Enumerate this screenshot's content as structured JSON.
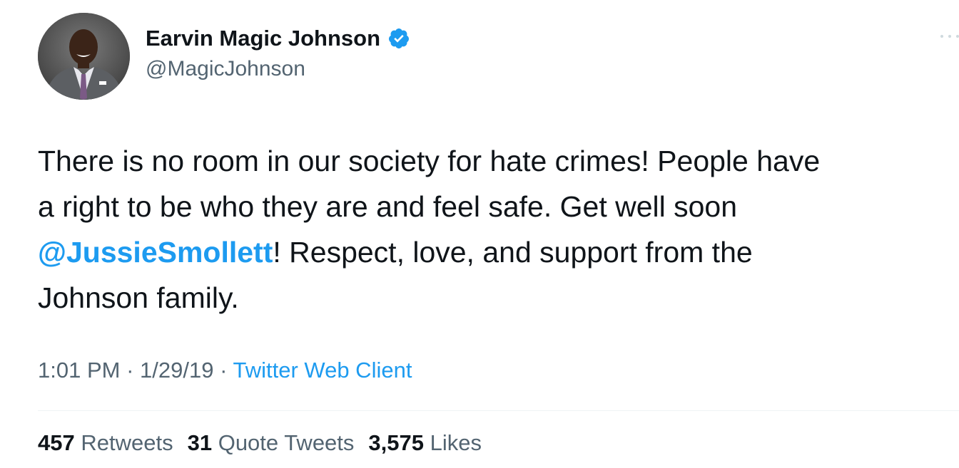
{
  "author": {
    "display_name": "Earvin Magic Johnson",
    "handle": "@MagicJohnson",
    "verified": true,
    "avatar": "profile-photo"
  },
  "tweet": {
    "lines": [
      {
        "segments": [
          {
            "text": "There is no room in our society for hate crimes! People have"
          }
        ]
      },
      {
        "segments": [
          {
            "text": "a right to be who they are and feel safe. Get well soon"
          }
        ]
      },
      {
        "segments": [
          {
            "text": "@JussieSmollett",
            "mention": true
          },
          {
            "text": "! Respect, love, and support from the"
          }
        ]
      },
      {
        "segments": [
          {
            "text": "Johnson family."
          }
        ]
      }
    ]
  },
  "meta": {
    "time": "1:01 PM",
    "separator": "·",
    "date": "1/29/19",
    "source": "Twitter Web Client"
  },
  "stats": {
    "retweets_count": "457",
    "retweets_label": "Retweets",
    "quotes_count": "31",
    "quotes_label": "Quote Tweets",
    "likes_count": "3,575",
    "likes_label": "Likes"
  },
  "colors": {
    "accent": "#1d9bf0",
    "text": "#0f1419",
    "secondary": "#536471",
    "divider": "#eff3f4"
  },
  "icons": {
    "verified": "verified-badge-icon",
    "more": "more-options-icon"
  }
}
